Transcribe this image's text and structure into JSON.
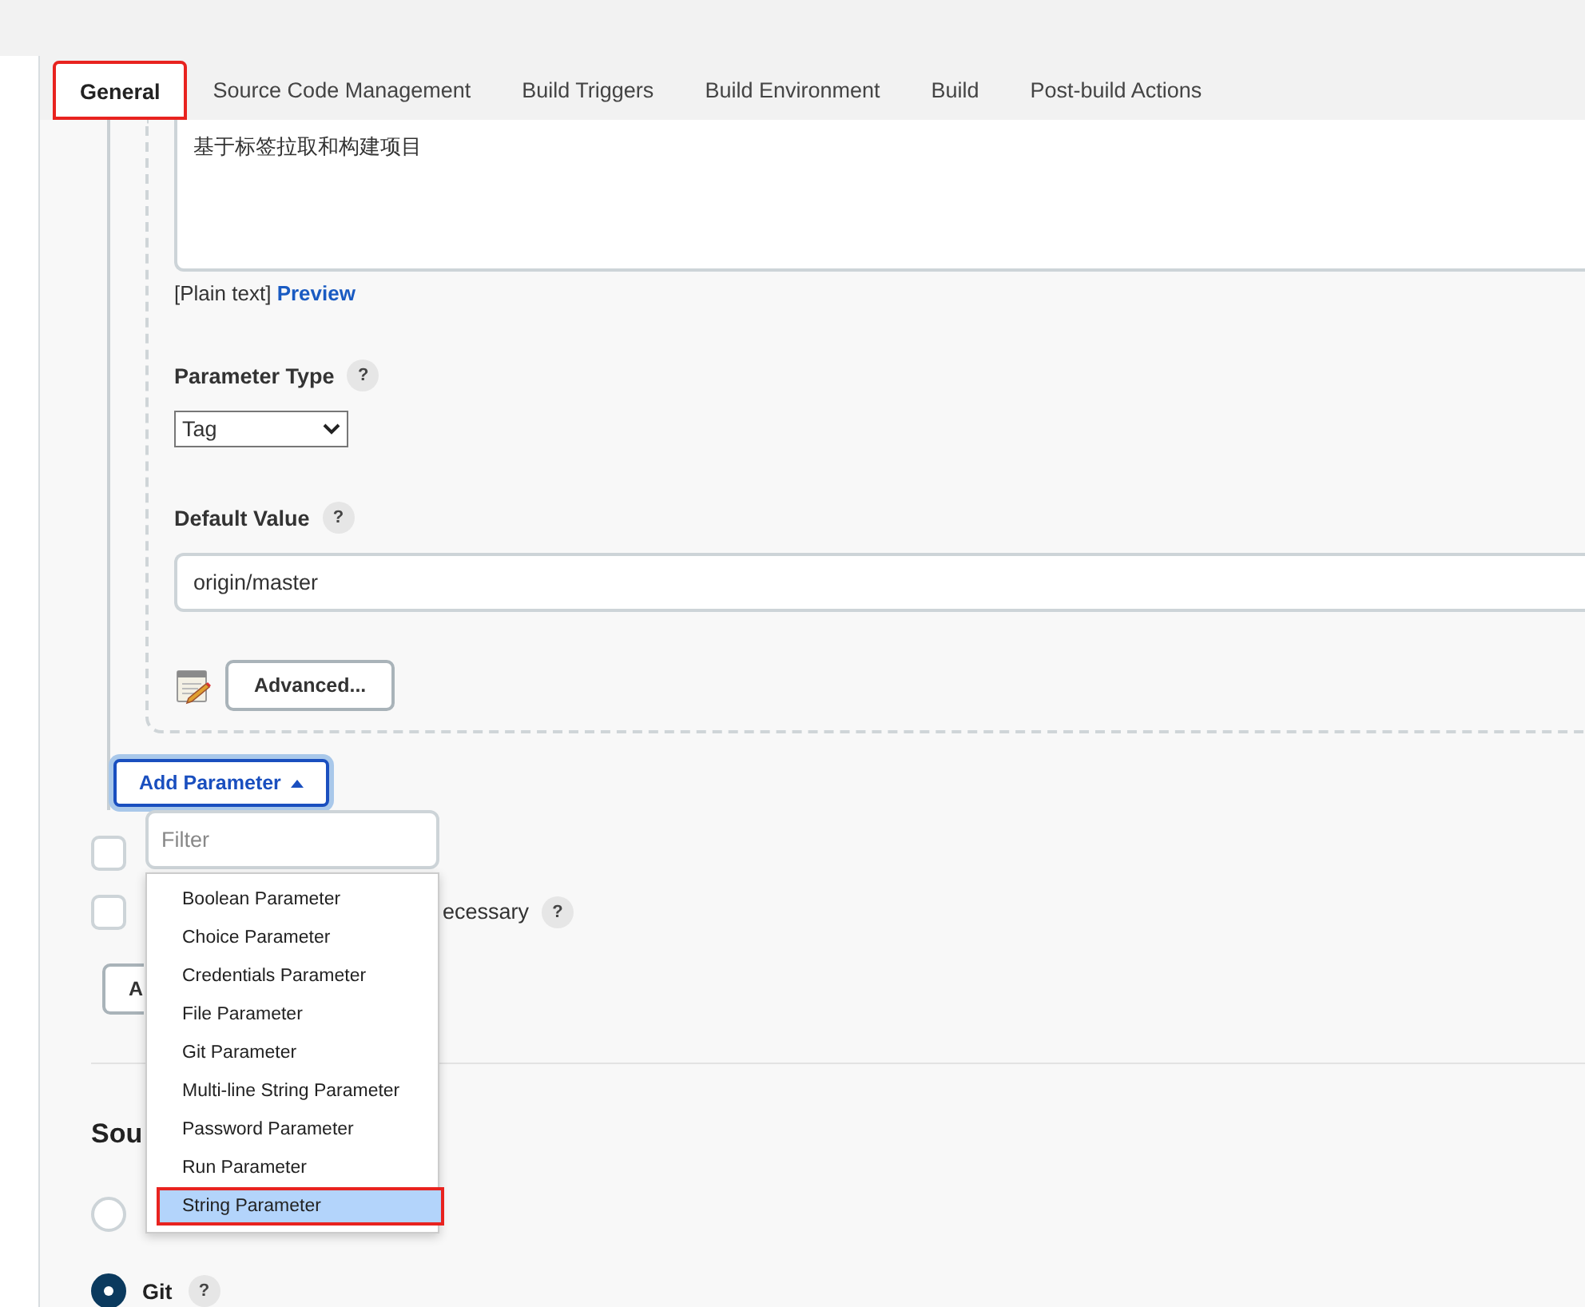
{
  "tabs": [
    {
      "label": "General",
      "selected": true,
      "annotated": true
    },
    {
      "label": "Source Code Management",
      "selected": false,
      "annotated": false
    },
    {
      "label": "Build Triggers",
      "selected": false,
      "annotated": false
    },
    {
      "label": "Build Environment",
      "selected": false,
      "annotated": false
    },
    {
      "label": "Build",
      "selected": false,
      "annotated": false
    },
    {
      "label": "Post-build Actions",
      "selected": false,
      "annotated": false
    }
  ],
  "description": {
    "value": "基于标签拉取和构建项目",
    "format_label": "[Plain text]",
    "preview_link": "Preview"
  },
  "parameter_type": {
    "label": "Parameter Type",
    "help": "?",
    "value": "Tag"
  },
  "default_value": {
    "label": "Default Value",
    "help": "?",
    "value": "origin/master"
  },
  "advanced_button": "Advanced...",
  "add_parameter": {
    "label": "Add Parameter",
    "expanded": true
  },
  "filter": {
    "placeholder": "Filter"
  },
  "menu_items": [
    {
      "label": "Boolean Parameter",
      "selected": false,
      "annotated": false
    },
    {
      "label": "Choice Parameter",
      "selected": false,
      "annotated": false
    },
    {
      "label": "Credentials Parameter",
      "selected": false,
      "annotated": false
    },
    {
      "label": "File Parameter",
      "selected": false,
      "annotated": false
    },
    {
      "label": "Git Parameter",
      "selected": false,
      "annotated": false
    },
    {
      "label": "Multi-line String Parameter",
      "selected": false,
      "annotated": false
    },
    {
      "label": "Password Parameter",
      "selected": false,
      "annotated": false
    },
    {
      "label": "Run Parameter",
      "selected": false,
      "annotated": false
    },
    {
      "label": "String Parameter",
      "selected": true,
      "annotated": true
    }
  ],
  "options": [
    {
      "checked": false
    },
    {
      "label": "ecessary",
      "help": "?",
      "checked": false
    }
  ],
  "partial_button": "A",
  "scm": {
    "heading": "Sou",
    "options": [
      {
        "selected": false
      },
      {
        "label": "Git",
        "help": "?",
        "selected": true
      }
    ]
  }
}
